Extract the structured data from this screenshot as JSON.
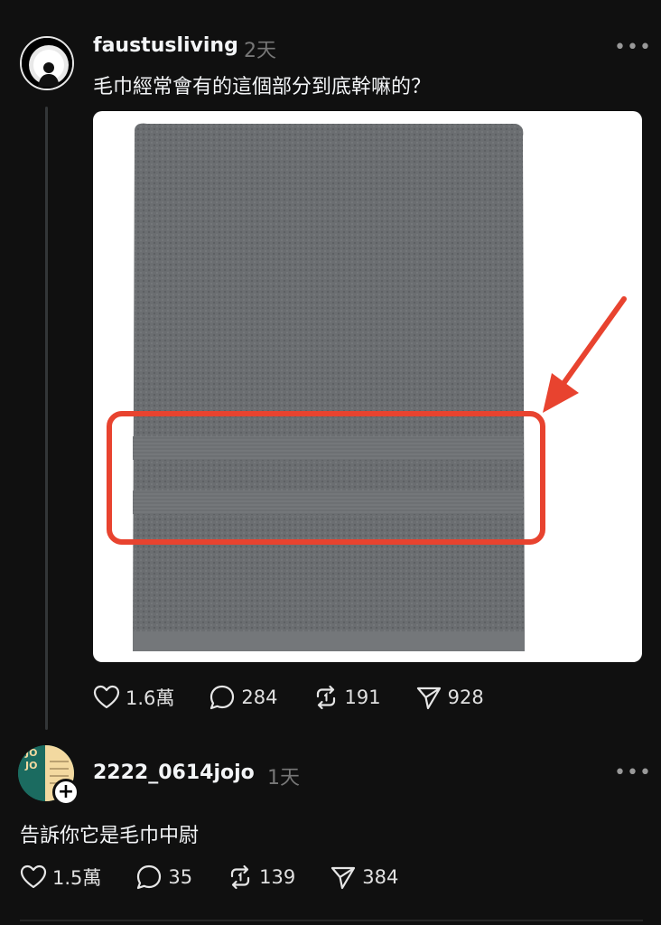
{
  "post": {
    "username": "faustusliving",
    "time": "2天",
    "more": "•••",
    "text": "毛巾經常會有的這個部分到底幹嘛的？",
    "likes": "1.6萬",
    "comments": "284",
    "reposts": "191",
    "shares": "928"
  },
  "reply": {
    "username": "2222_0614jojo",
    "time": "1天",
    "more": "•••",
    "avatar_text": "JOJO",
    "plus": "+",
    "text": "告訴你它是毛巾中尉",
    "likes": "1.5萬",
    "comments": "35",
    "reposts": "139",
    "shares": "384"
  },
  "colors": {
    "background": "#101010",
    "highlight": "#e8432f",
    "towel": "#6e7174"
  }
}
